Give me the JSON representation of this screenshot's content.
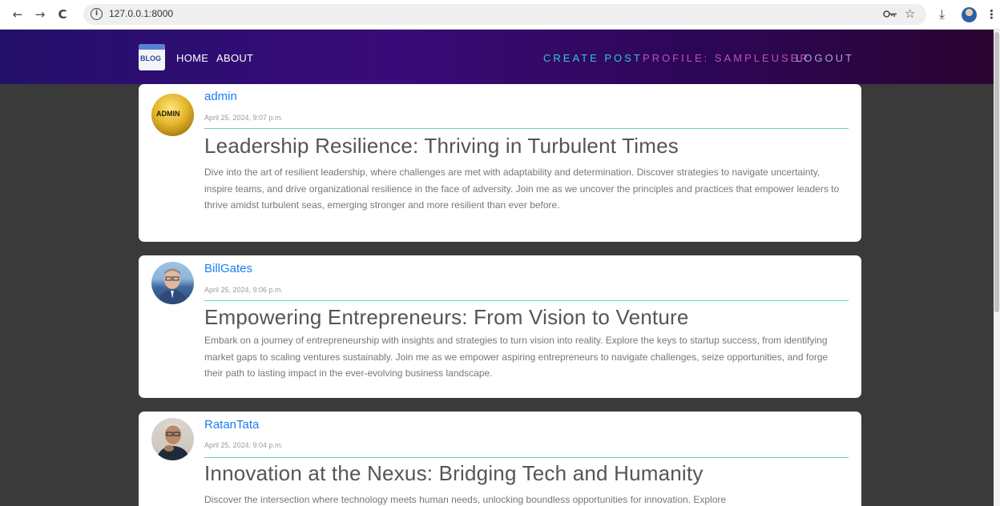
{
  "browser": {
    "url": "127.0.0.1:8000",
    "back_glyph": "←",
    "forward_glyph": "→",
    "reload_glyph": "C",
    "info_glyph": "i",
    "bookmark_glyph": "☆",
    "download_glyph": "⤓",
    "menu_glyph": "⋮"
  },
  "header": {
    "logo_text": "BLOG",
    "nav_left": [
      "HOME",
      "ABOUT"
    ],
    "nav_right": {
      "create": "CREATE POST",
      "profile": "PROFILE: SAMPLEUSER",
      "logout": "LOGOUT"
    },
    "colors": {
      "create": "#36c6cf",
      "profile": "#c04fc0",
      "logout": "#a8a8d8"
    }
  },
  "posts": [
    {
      "author": "admin",
      "avatar_text": "ADMIN",
      "date": "April 25, 2024, 9:07 p.m.",
      "title": "Leadership Resilience: Thriving in Turbulent Times",
      "body": "Dive into the art of resilient leadership, where challenges are met with adaptability and determination. Discover strategies to navigate uncertainty, inspire teams, and drive organizational resilience in the face of adversity. Join me as we uncover the principles and practices that empower leaders to thrive amidst turbulent seas, emerging stronger and more resilient than ever before."
    },
    {
      "author": "BillGates",
      "date": "April 25, 2024, 9:06 p.m.",
      "title": "Empowering Entrepreneurs: From Vision to Venture",
      "body": "Embark on a journey of entrepreneurship with insights and strategies to turn vision into reality. Explore the keys to startup success, from identifying market gaps to scaling ventures sustainably. Join me as we empower aspiring entrepreneurs to navigate challenges, seize opportunities, and forge their path to lasting impact in the ever-evolving business landscape."
    },
    {
      "author": "RatanTata",
      "date": "April 25, 2024, 9:04 p.m.",
      "title": "Innovation at the Nexus: Bridging Tech and Humanity",
      "body": "Discover the intersection where technology meets human needs, unlocking boundless opportunities for innovation. Explore"
    }
  ]
}
